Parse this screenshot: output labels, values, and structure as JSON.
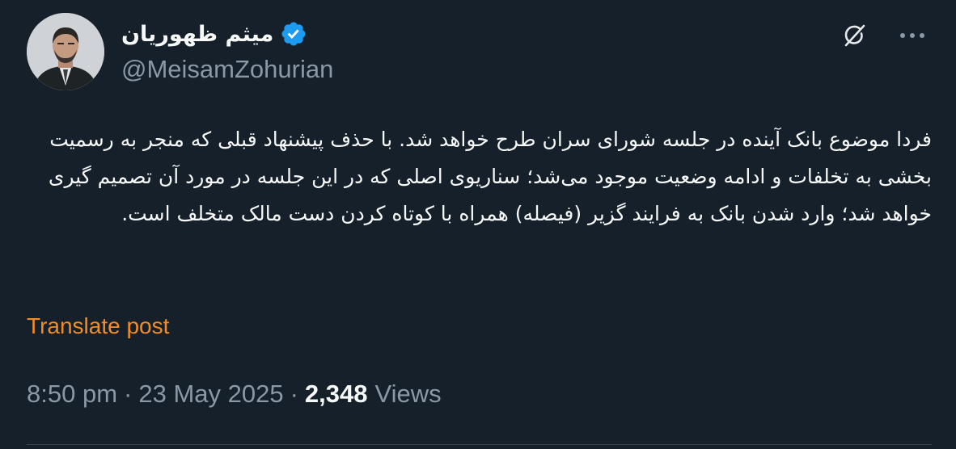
{
  "author": {
    "display_name": "میثم ظهوریان",
    "handle": "@MeisamZohurian",
    "verified": true
  },
  "icons": {
    "verified": "verified-badge-icon",
    "grok": "grok-icon",
    "more": "more-icon"
  },
  "post": {
    "text": "فردا موضوع بانک آینده در جلسه شورای سران طرح خواهد شد. با حذف پیشنهاد قبلی که منجر به رسمیت بخشی به تخلفات و ادامه وضعیت موجود می‌شد؛ سناریوی اصلی که در این جلسه در مورد آن تصمیم گیری خواهد شد؛ وارد شدن بانک به فرایند گزیر (فیصله) همراه با کوتاه کردن دست مالک متخلف است.",
    "translate_label": "Translate post"
  },
  "meta": {
    "time": "8:50 pm",
    "separator": "·",
    "date": "23 May 2025",
    "views_count": "2,348",
    "views_label": "Views"
  },
  "colors": {
    "background": "#15202b",
    "verified": "#1d9bf0",
    "translate_link": "#f48c24",
    "secondary_text": "#8b98a5"
  }
}
